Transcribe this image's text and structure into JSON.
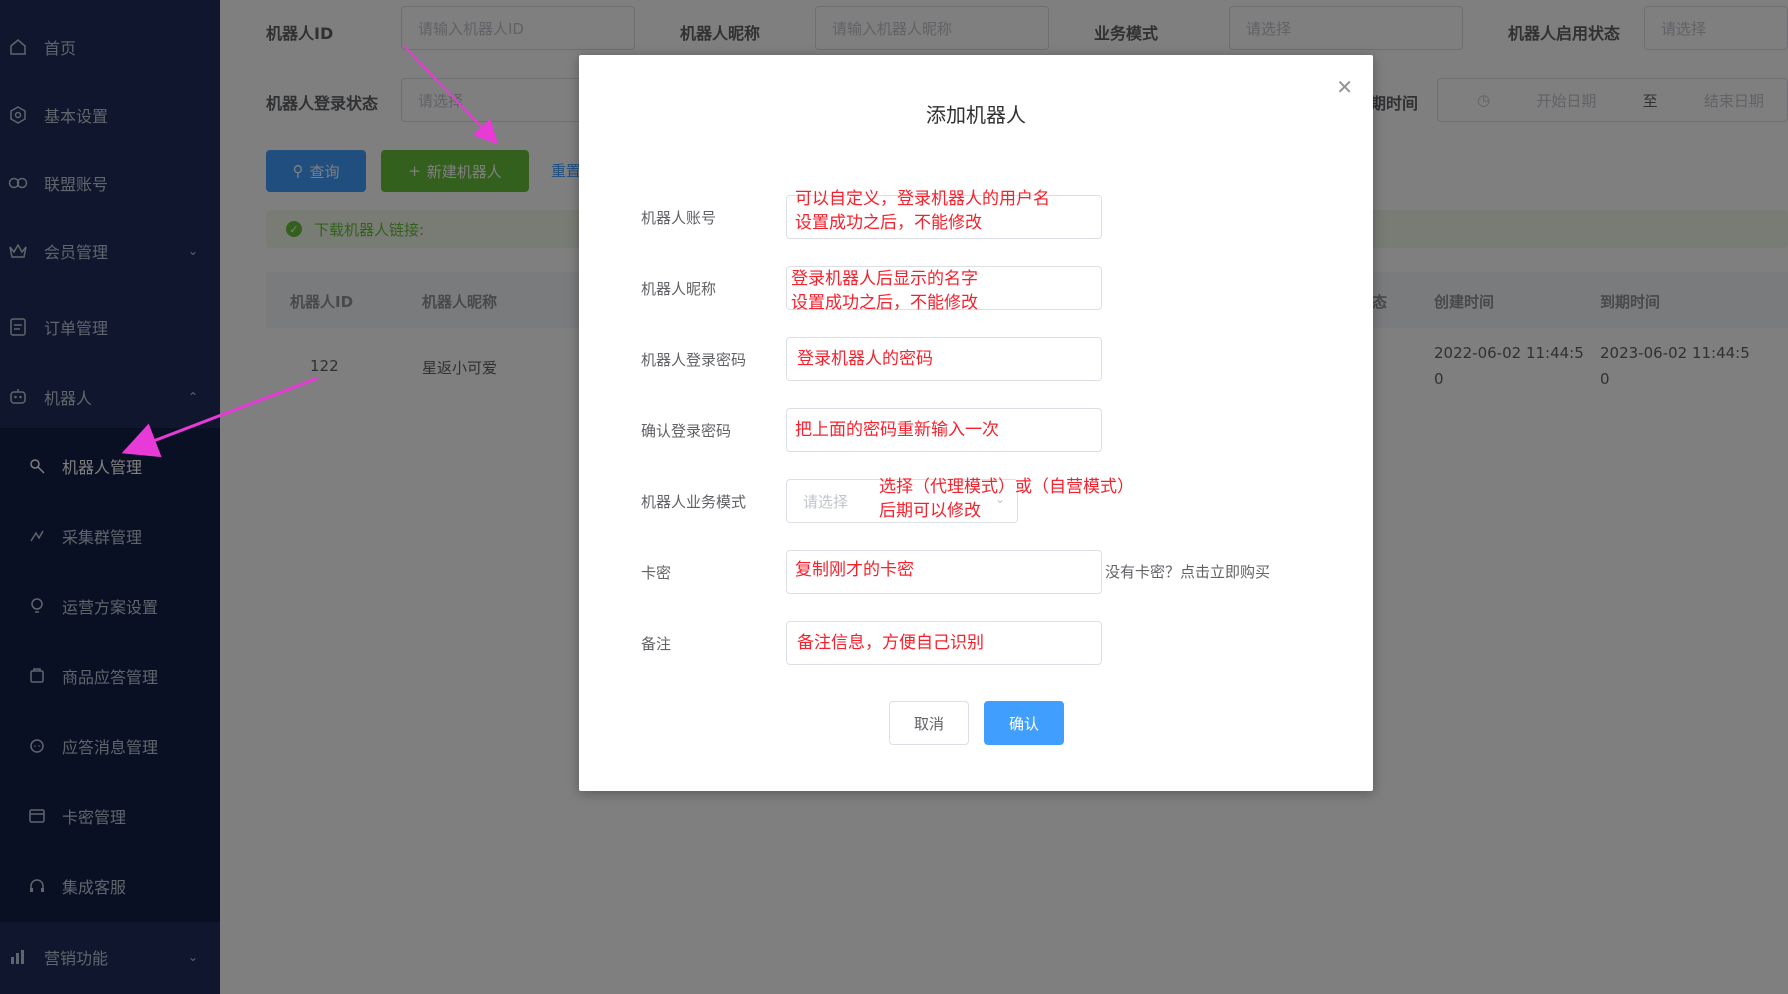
{
  "sidebar": {
    "items": [
      {
        "label": "首页",
        "icon": "home-icon"
      },
      {
        "label": "基本设置",
        "icon": "settings-icon"
      },
      {
        "label": "联盟账号",
        "icon": "link-icon"
      },
      {
        "label": "会员管理",
        "icon": "crown-icon"
      },
      {
        "label": "订单管理",
        "icon": "order-icon"
      },
      {
        "label": "机器人",
        "icon": "robot-icon"
      }
    ],
    "sub_items": [
      {
        "label": "机器人管理",
        "icon": "wrench-icon"
      },
      {
        "label": "采集群管理",
        "icon": "collect-icon"
      },
      {
        "label": "运营方案设置",
        "icon": "bulb-icon"
      },
      {
        "label": "商品应答管理",
        "icon": "goods-icon"
      },
      {
        "label": "应答消息管理",
        "icon": "message-icon"
      },
      {
        "label": "卡密管理",
        "icon": "card-icon"
      },
      {
        "label": "集成客服",
        "icon": "headset-icon"
      }
    ],
    "last_item": {
      "label": "营销功能",
      "icon": "chart-icon"
    }
  },
  "filters": {
    "robot_id_label": "机器人ID",
    "robot_id_placeholder": "请输入机器人ID",
    "nickname_label": "机器人昵称",
    "nickname_placeholder": "请输入机器人昵称",
    "mode_label": "业务模式",
    "mode_placeholder": "请选择",
    "enable_label": "机器人启用状态",
    "enable_placeholder": "请选择",
    "login_label": "机器人登录状态",
    "login_placeholder": "请选择",
    "expire_label": "期时间",
    "start_placeholder": "开始日期",
    "range_sep": "至",
    "end_placeholder": "结束日期"
  },
  "toolbar": {
    "search_label": "查询",
    "new_label": "新建机器人",
    "reset_label": "重置"
  },
  "alert": {
    "text": "下载机器人链接:"
  },
  "table": {
    "headers": [
      "机器人ID",
      "机器人昵称",
      "态",
      "创建时间",
      "到期时间"
    ],
    "row": {
      "id": "122",
      "nickname": "星返小可爱",
      "created_line1": "2022-06-02 11:44:5",
      "created_line2": "0",
      "expire_line1": "2023-06-02 11:44:5",
      "expire_line2": "0"
    }
  },
  "dialog": {
    "title": "添加机器人",
    "fields": {
      "account": {
        "label": "机器人账号",
        "note1": "可以自定义，登录机器人的用户名",
        "note2": "设置成功之后，不能修改"
      },
      "nickname": {
        "label": "机器人昵称",
        "note1": "登录机器人后显示的名字",
        "note2": "设置成功之后，不能修改"
      },
      "password": {
        "label": "机器人登录密码",
        "note1": "登录机器人的密码"
      },
      "confirm": {
        "label": "确认登录密码",
        "note1": "把上面的密码重新输入一次"
      },
      "mode": {
        "label": "机器人业务模式",
        "placeholder": "请选择",
        "note1": "选择（代理模式）或（自营模式）",
        "note2": "后期可以修改"
      },
      "card": {
        "label": "卡密",
        "note1": "复制刚才的卡密",
        "buy_link": "没有卡密？点击立即购买"
      },
      "remark": {
        "label": "备注",
        "note1": "备注信息，方便自己识别"
      }
    },
    "cancel_label": "取消",
    "ok_label": "确认"
  },
  "colors": {
    "sidebar": "#1f2d5a",
    "primary": "#409eff",
    "success": "#67c23a",
    "annotation": "#f5222d",
    "arrow": "#e83ad6"
  }
}
